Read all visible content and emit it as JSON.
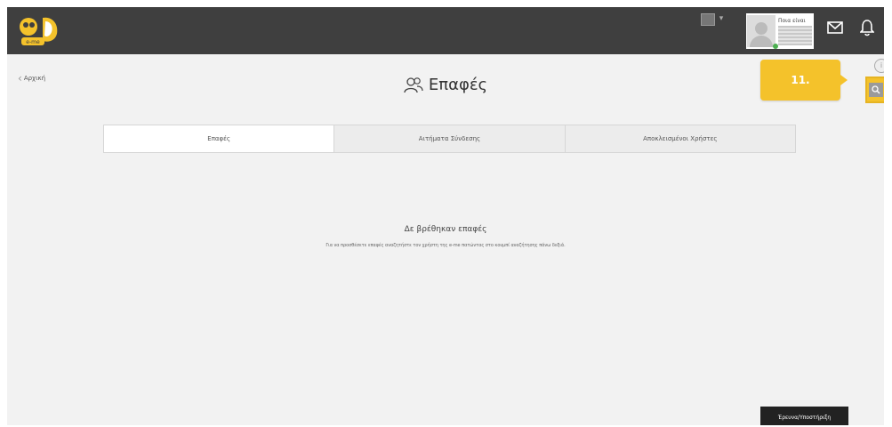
{
  "header": {
    "user_label": "Ποια είναι",
    "lang_arrow": "▾"
  },
  "nav": {
    "back_label": "Αρχική",
    "back_chevron": "‹"
  },
  "page": {
    "title": "Επαφές"
  },
  "tabs": [
    {
      "label": "Επαφές",
      "active": true
    },
    {
      "label": "Αιτήματα Σύνδεσης",
      "active": false
    },
    {
      "label": "Αποκλεισμένοι Χρήστες",
      "active": false
    }
  ],
  "empty_state": {
    "title": "Δε βρέθηκαν επαφές",
    "text": "Για να προσθέσετε επαφές αναζητήστε τον χρήστη της e-me πατώντας στο κουμπί αναζήτησης πάνω δεξιά."
  },
  "sidebar_tools": {
    "info_icon_glyph": "i",
    "tooltip_label": "11."
  },
  "footer": {
    "help_label": "Έρευνα/Υποστήριξη"
  },
  "colors": {
    "topbar": "#3f3f3f",
    "accent": "#f4c22b",
    "background": "#f2f2f2"
  },
  "icons": [
    "app-logo-icon",
    "mail-icon",
    "bell-icon",
    "contacts-icon",
    "search-icon",
    "info-icon",
    "avatar-icon"
  ]
}
